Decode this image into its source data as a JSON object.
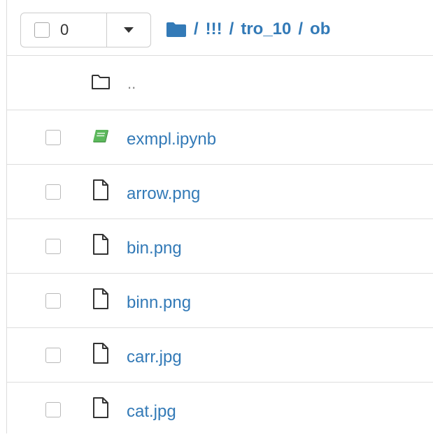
{
  "toolbar": {
    "selected_count": "0"
  },
  "breadcrumb": {
    "separator": "/",
    "items": [
      {
        "label": "!!!"
      },
      {
        "label": "tro_10"
      },
      {
        "label": "ob"
      }
    ]
  },
  "parent_dir": {
    "label": ".."
  },
  "files": [
    {
      "name": "exmpl.ipynb",
      "icon": "notebook-icon"
    },
    {
      "name": "arrow.png",
      "icon": "file-icon"
    },
    {
      "name": "bin.png",
      "icon": "file-icon"
    },
    {
      "name": "binn.png",
      "icon": "file-icon"
    },
    {
      "name": "carr.jpg",
      "icon": "file-icon"
    },
    {
      "name": "cat.jpg",
      "icon": "file-icon"
    }
  ],
  "colors": {
    "link": "#337ab7",
    "notebook_icon": "#5cb85c",
    "border": "#dddddd"
  }
}
